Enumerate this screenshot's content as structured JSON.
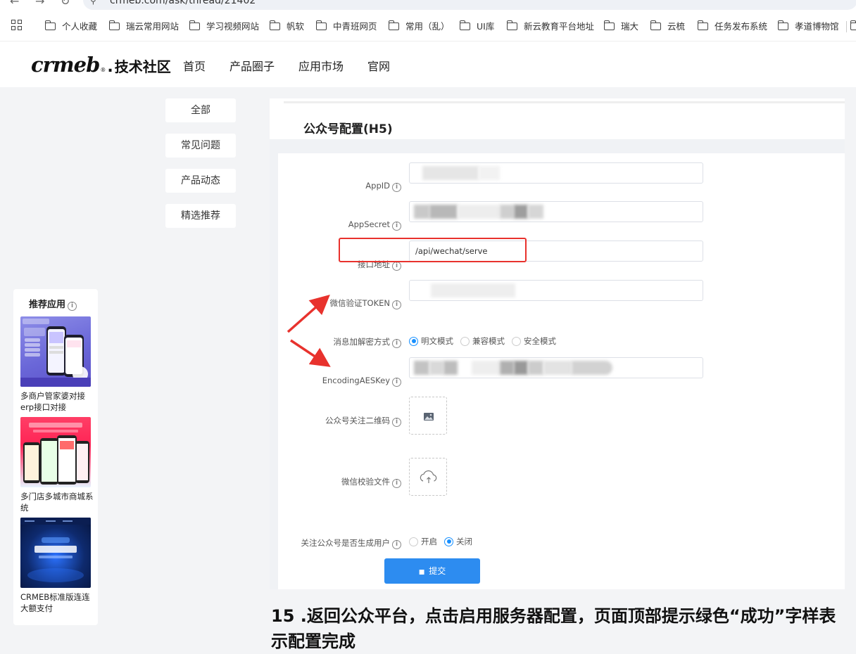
{
  "browser": {
    "url": "crmeb.com/ask/thread/21402",
    "bookmarks": [
      "个人收藏",
      "瑞云常用网站",
      "学习视频网站",
      "帆软",
      "中青班网页",
      "常用（乱）",
      "UI库",
      "新云教育平台地址",
      "瑞大",
      "云梳",
      "任务发布系统",
      "孝道博物馆"
    ]
  },
  "site": {
    "logo_brand": "crmeb",
    "logo_reg": "®",
    "logo_dot": ".",
    "logo_community": "技术社区",
    "nav": [
      "首页",
      "产品圈子",
      "应用市场",
      "官网"
    ]
  },
  "categories": [
    "全部",
    "常见问题",
    "产品动态",
    "精选推荐"
  ],
  "recommend": {
    "title": "推荐应用",
    "info": "i",
    "apps": [
      {
        "label": "多商户管家婆对接erp接口对接"
      },
      {
        "label": "多门店多城市商城系统"
      },
      {
        "label": "CRMEB标准版连连大额支付"
      }
    ]
  },
  "form": {
    "title": "公众号配置(H5)",
    "info": "i",
    "appid_label": "AppID",
    "appsecret_label": "AppSecret",
    "api_label": "接口地址",
    "api_value": "/api/wechat/serve",
    "token_label": "微信验证TOKEN",
    "encrypt_label": "消息加解密方式",
    "encrypt_options": [
      "明文模式",
      "兼容模式",
      "安全模式"
    ],
    "aes_label": "EncodingAESKey",
    "qrcode_label": "公众号关注二维码",
    "verify_file_label": "微信校验文件",
    "follow_label": "关注公众号是否生成用户",
    "follow_options": [
      "开启",
      "关闭"
    ],
    "submit": "提交"
  },
  "step_text": "15 .返回公众平台，点击启用服务器配置，页面顶部提示绿色“成功”字样表示配置完成",
  "colors": {
    "accent": "#2d8cf0",
    "highlight": "#e8322d"
  }
}
